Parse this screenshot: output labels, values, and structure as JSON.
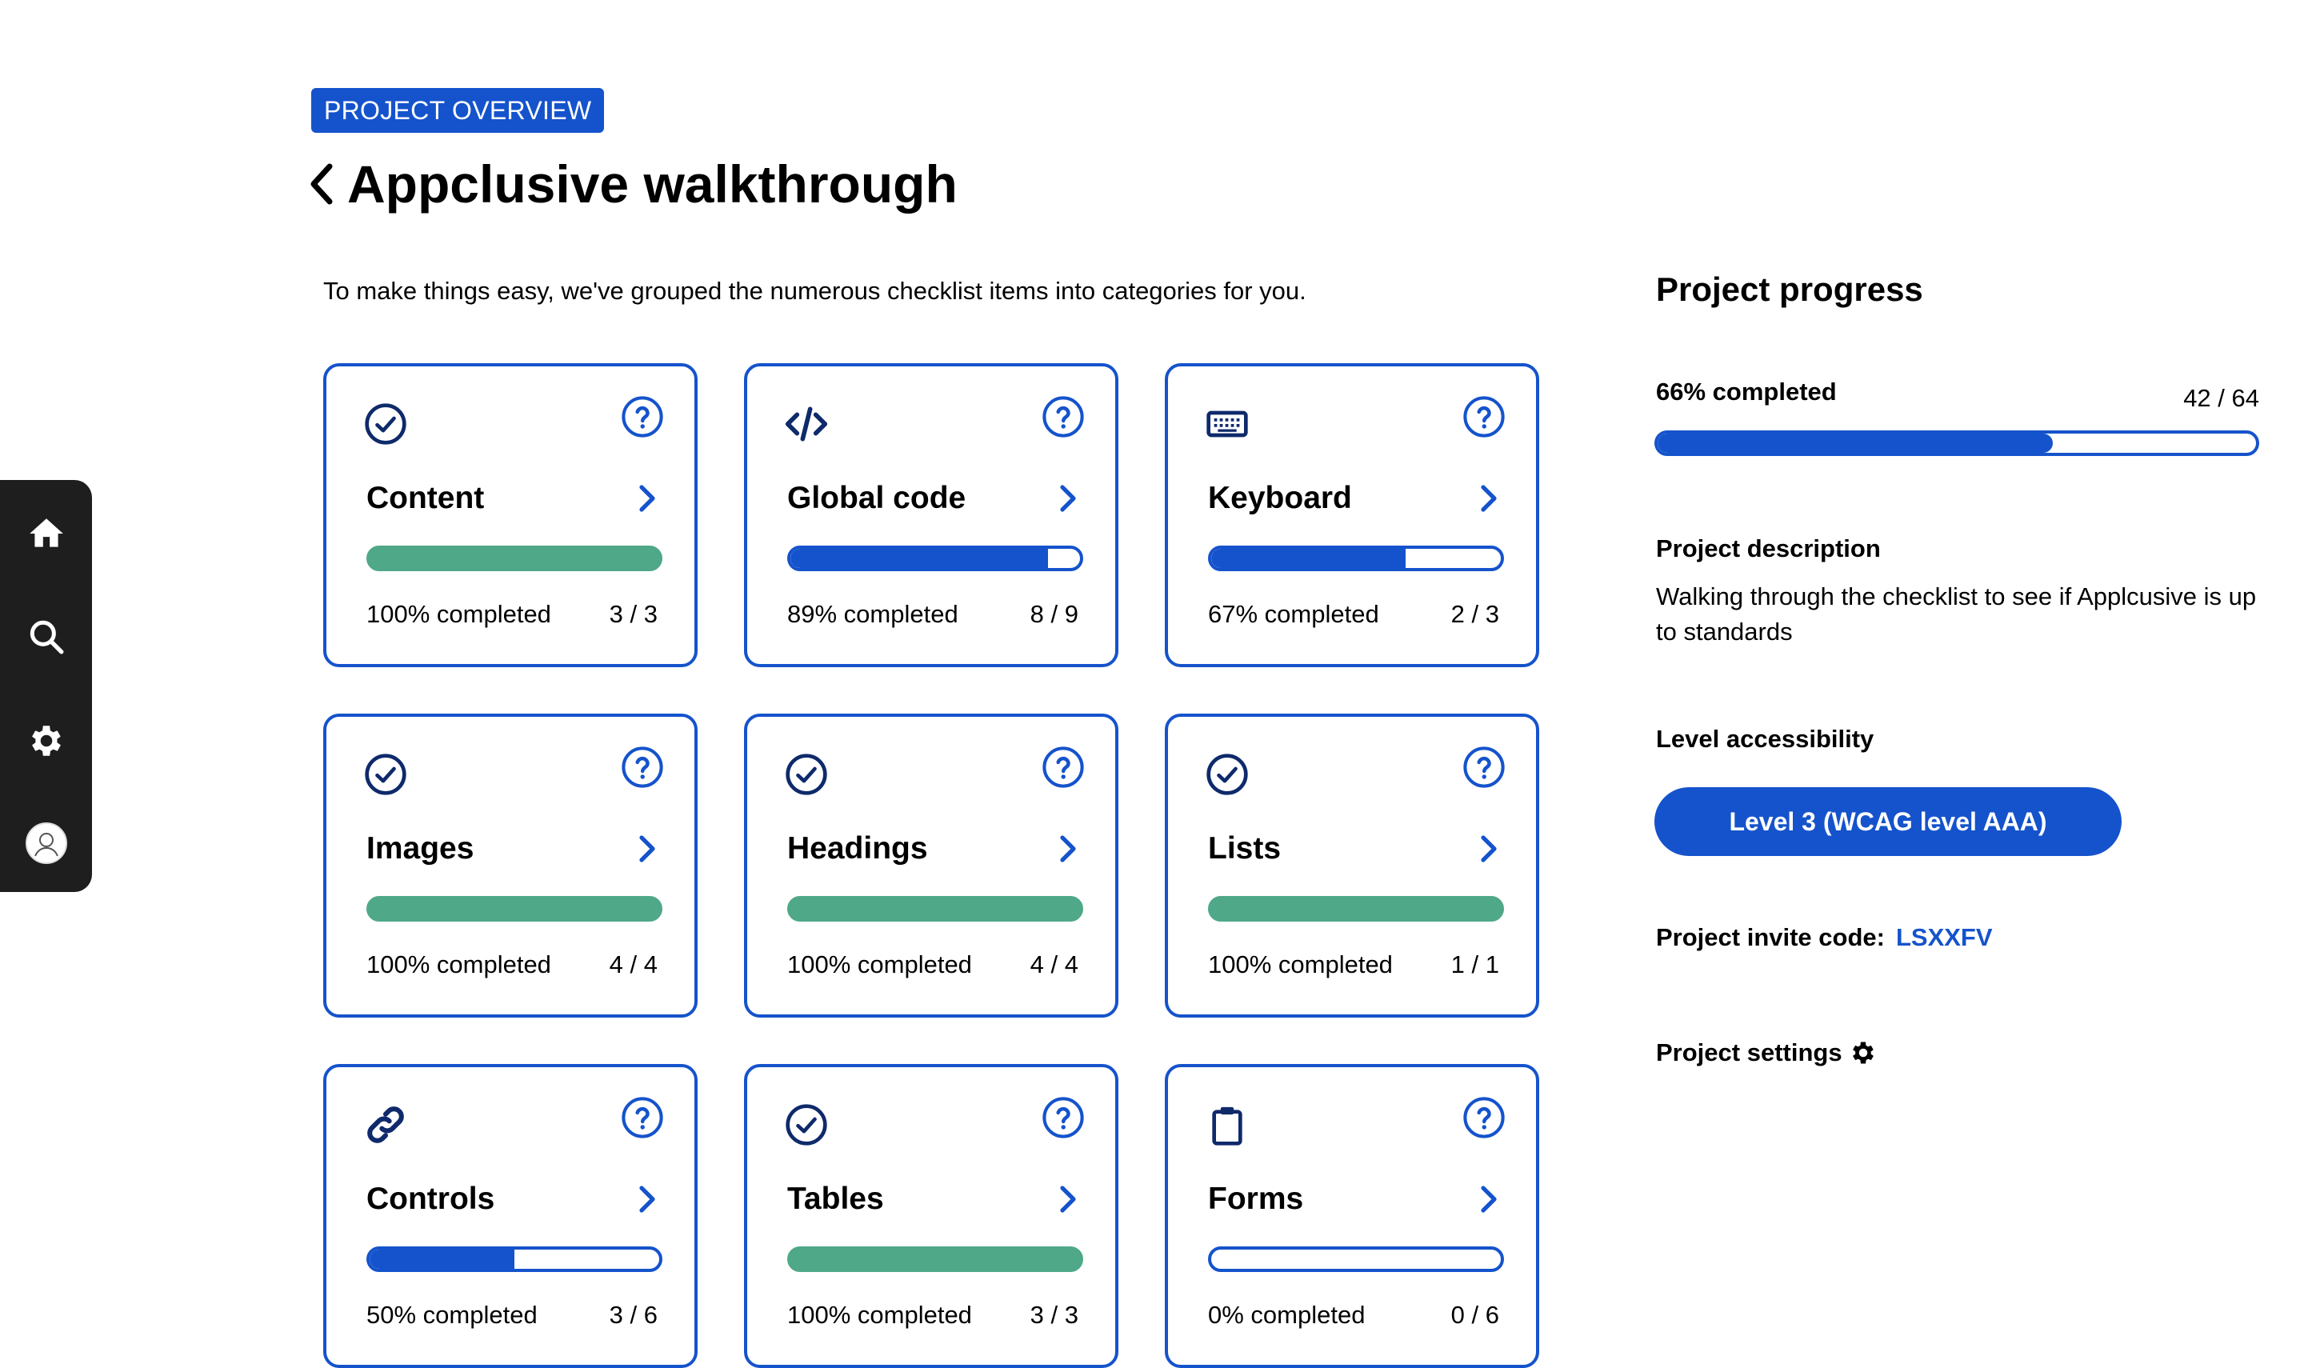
{
  "nav": {
    "items": [
      {
        "name": "home-icon"
      },
      {
        "name": "search-icon"
      },
      {
        "name": "gear-icon"
      },
      {
        "name": "avatar"
      }
    ]
  },
  "header": {
    "badge": "PROJECT OVERVIEW",
    "title": "Appclusive walkthrough",
    "back_icon": "chevron-left-icon"
  },
  "intro": "To make things easy, we've grouped the numerous checklist items into categories for you.",
  "colors": {
    "primary": "#1553cc",
    "complete": "#4fa888",
    "nav_bg": "#1e1e1e",
    "icon_dark": "#0f2a6b"
  },
  "categories": [
    {
      "title": "Content",
      "icon": "check-circle-icon",
      "progress": 1.0,
      "pct_label": "100% completed",
      "count": "3 / 3"
    },
    {
      "title": "Global code",
      "icon": "code-icon",
      "progress": 0.89,
      "pct_label": "89% completed",
      "count": "8 / 9"
    },
    {
      "title": "Keyboard",
      "icon": "keyboard-icon",
      "progress": 0.67,
      "pct_label": "67% completed",
      "count": "2 / 3"
    },
    {
      "title": "Images",
      "icon": "check-circle-icon",
      "progress": 1.0,
      "pct_label": "100% completed",
      "count": "4 / 4"
    },
    {
      "title": "Headings",
      "icon": "check-circle-icon",
      "progress": 1.0,
      "pct_label": "100% completed",
      "count": "4 / 4"
    },
    {
      "title": "Lists",
      "icon": "check-circle-icon",
      "progress": 1.0,
      "pct_label": "100% completed",
      "count": "1 / 1"
    },
    {
      "title": "Controls",
      "icon": "link-icon",
      "progress": 0.5,
      "pct_label": "50% completed",
      "count": "3 / 6"
    },
    {
      "title": "Tables",
      "icon": "check-circle-icon",
      "progress": 1.0,
      "pct_label": "100% completed",
      "count": "3 / 3"
    },
    {
      "title": "Forms",
      "icon": "clipboard-icon",
      "progress": 0.0,
      "pct_label": "0% completed",
      "count": "0 / 6"
    }
  ],
  "progress_panel": {
    "title": "Project progress",
    "pct_label": "66% completed",
    "count": "42 / 64",
    "progress": 0.66,
    "description_label": "Project description",
    "description": "Walking through the checklist to see if Applcusive is up to standards",
    "level_label": "Level accessibility",
    "level_button": "Level 3 (WCAG level AAA)",
    "invite_label": "Project invite code:",
    "invite_code": "LSXXFV",
    "settings_label": "Project settings",
    "settings_icon": "gear-icon"
  }
}
